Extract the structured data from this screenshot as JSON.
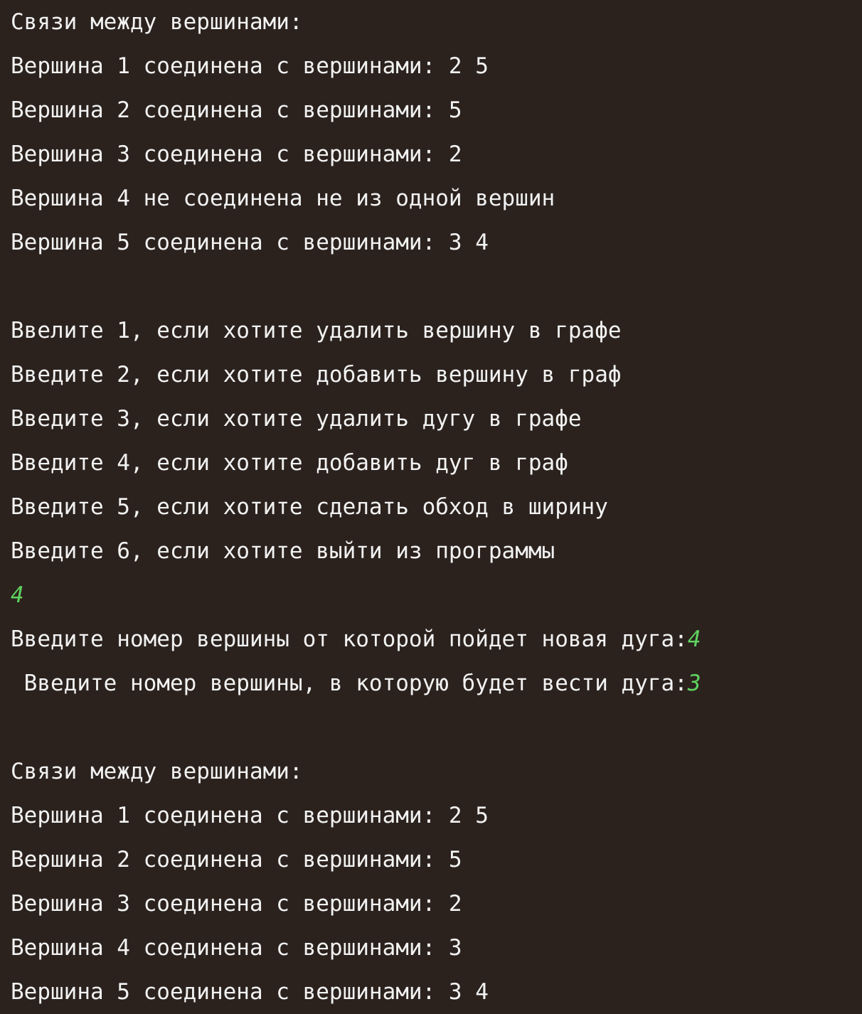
{
  "console": {
    "block1": {
      "header": "Связи между вершинами:",
      "lines": [
        "Вершина 1 соединена с вершинами: 2 5",
        "Вершина 2 соединена с вершинами: 5",
        "Вершина 3 соединена с вершинами: 2",
        "Вершина 4 не соединена не из одной вершин",
        "Вершина 5 соединена с вершинами: 3 4"
      ]
    },
    "menu": [
      "Ввелите 1, если хотите удалить вершину в графе",
      "Введите 2, если хотите добавить вершину в граф",
      "Введите 3, если хотите удалить дугу в графе",
      "Введите 4, если хотите добавить дуг в граф",
      "Введите 5, если хотите сделать обход в ширину",
      "Введите 6, если хотите выйти из программы"
    ],
    "choice_input": "4",
    "prompt_from": "Введите номер вершины от которой пойдет новая дуга:",
    "input_from": "4",
    "prompt_to": " Введите номер вершины, в которую будет вести дуга:",
    "input_to": "3",
    "block2": {
      "header": "Связи между вершинами:",
      "lines": [
        "Вершина 1 соединена с вершинами: 2 5",
        "Вершина 2 соединена с вершинами: 5",
        "Вершина 3 соединена с вершинами: 2",
        "Вершина 4 соединена с вершинами: 3",
        "Вершина 5 соединена с вершинами: 3 4"
      ]
    },
    "colors": {
      "background": "#2b221e",
      "text": "#f2f2f2",
      "user_input": "#5fd35f"
    }
  }
}
